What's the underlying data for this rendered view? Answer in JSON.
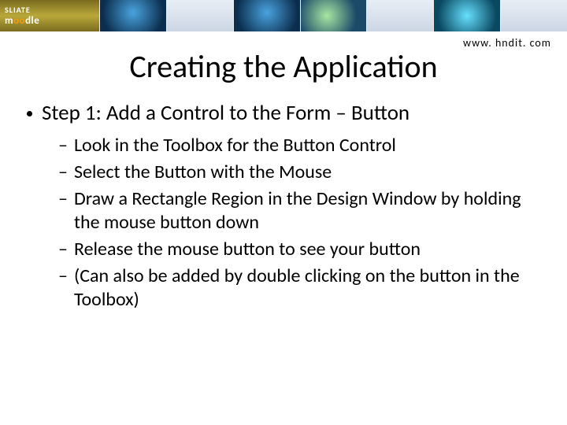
{
  "banner": {
    "logo_top": "SLIATE",
    "logo_bottom_pre": "m",
    "logo_bottom_mid": "oo",
    "logo_bottom_post": "dle"
  },
  "url": "www. hndit. com",
  "title": "Creating the Application",
  "bullet1": "Step 1:  Add a Control to the Form – Button",
  "sub": [
    "Look in the Toolbox for the Button Control",
    "Select the Button with the Mouse",
    "Draw a Rectangle Region in the Design Window by holding the mouse button down",
    "Release the mouse button to see your button",
    "(Can also be added by double clicking on the button in the Toolbox)"
  ]
}
